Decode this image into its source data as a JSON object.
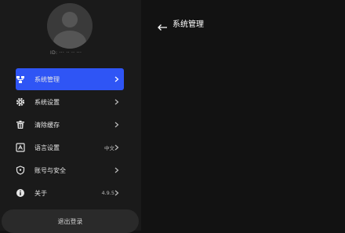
{
  "profile": {
    "user_id": "ID: ··· ·· ·· ···"
  },
  "menu": {
    "items": [
      {
        "label": "系统管理",
        "icon": "hierarchy-icon"
      },
      {
        "label": "系统设置",
        "icon": "gear-icon"
      },
      {
        "label": "清除缓存",
        "icon": "trash-icon"
      },
      {
        "label": "语言设置",
        "icon": "language-icon",
        "value": "中文"
      },
      {
        "label": "账号与安全",
        "icon": "shield-icon"
      },
      {
        "label": "关于",
        "icon": "info-icon",
        "value": "4.9.5"
      }
    ]
  },
  "logout_label": "退出登录",
  "page": {
    "title": "系统管理"
  },
  "colors": {
    "accent": "#2f55f5",
    "background": "#121212",
    "sidebar": "#1a1a1a"
  }
}
